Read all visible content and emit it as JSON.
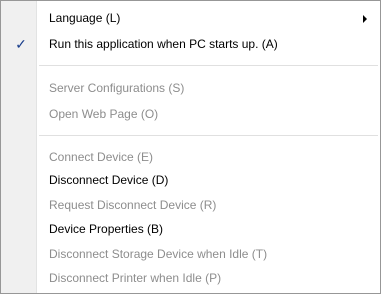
{
  "menu": {
    "items": [
      {
        "label": "Language (L)",
        "state": "enabled",
        "submenu": true
      },
      {
        "label": "Run this application when PC starts up. (A)",
        "state": "enabled",
        "checked": true
      },
      {
        "label": "Server Configurations (S)",
        "state": "disabled"
      },
      {
        "label": "Open Web Page (O)",
        "state": "disabled"
      },
      {
        "label": "Connect Device (E)",
        "state": "disabled"
      },
      {
        "label": "Disconnect Device (D)",
        "state": "enabled"
      },
      {
        "label": "Request Disconnect Device (R)",
        "state": "disabled"
      },
      {
        "label": "Device Properties (B)",
        "state": "enabled"
      },
      {
        "label": "Disconnect Storage Device when Idle (T)",
        "state": "disabled"
      },
      {
        "label": "Disconnect Printer when Idle (P)",
        "state": "disabled"
      }
    ],
    "check_glyph": "✓",
    "colors": {
      "enabled_text": "#000000",
      "disabled_text": "#8d8d8d",
      "check": "#1a3e8c"
    },
    "icons": {
      "check": "check-icon",
      "submenu": "submenu-arrow-icon"
    }
  }
}
